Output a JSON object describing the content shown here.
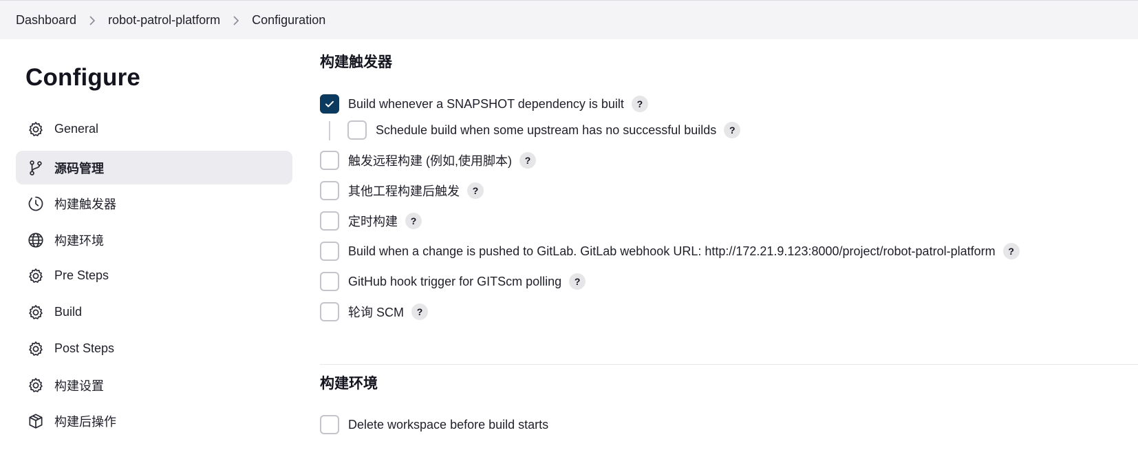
{
  "breadcrumb": {
    "items": [
      "Dashboard",
      "robot-patrol-platform",
      "Configuration"
    ]
  },
  "sidebar": {
    "title": "Configure",
    "items": [
      {
        "label": "General",
        "icon": "gear-icon"
      },
      {
        "label": "源码管理",
        "icon": "branch-icon",
        "active": true
      },
      {
        "label": "构建触发器",
        "icon": "clock-icon"
      },
      {
        "label": "构建环境",
        "icon": "globe-icon"
      },
      {
        "label": "Pre Steps",
        "icon": "gear-icon"
      },
      {
        "label": "Build",
        "icon": "gear-icon"
      },
      {
        "label": "Post Steps",
        "icon": "gear-icon"
      },
      {
        "label": "构建设置",
        "icon": "gear-icon"
      },
      {
        "label": "构建后操作",
        "icon": "package-icon"
      }
    ]
  },
  "triggers": {
    "title": "构建触发器",
    "options": [
      {
        "label": "Build whenever a SNAPSHOT dependency is built",
        "checked": true
      },
      {
        "label": "Schedule build when some upstream has no successful builds",
        "checked": false
      },
      {
        "label": "触发远程构建 (例如,使用脚本)",
        "checked": false
      },
      {
        "label": "其他工程构建后触发",
        "checked": false
      },
      {
        "label": "定时构建",
        "checked": false
      },
      {
        "label": "Build when a change is pushed to GitLab. GitLab webhook URL: http://172.21.9.123:8000/project/robot-patrol-platform",
        "checked": false
      },
      {
        "label": "GitHub hook trigger for GITScm polling",
        "checked": false
      },
      {
        "label": "轮询 SCM",
        "checked": false
      }
    ],
    "help_glyph": "?"
  },
  "environment": {
    "title": "构建环境",
    "options": [
      {
        "label": "Delete workspace before build starts",
        "checked": false
      }
    ]
  },
  "colors": {
    "checked_bg": "#0c3a5e",
    "active_nav_bg": "#ebebf0",
    "breadcrumb_bg": "#f4f4f6"
  }
}
